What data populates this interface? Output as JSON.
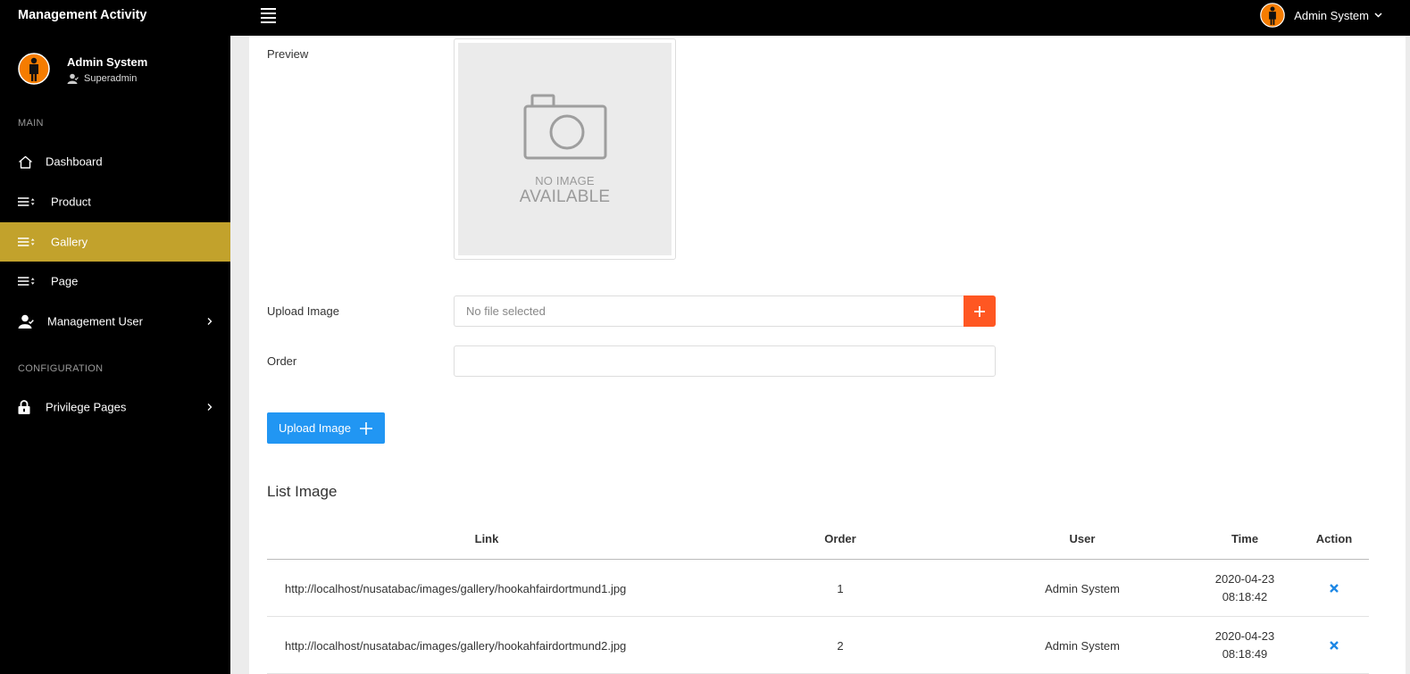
{
  "app": {
    "title": "Management Activity"
  },
  "header": {
    "user_name": "Admin System"
  },
  "sidebar": {
    "user": {
      "name": "Admin System",
      "role": "Superadmin"
    },
    "sections": {
      "main": "MAIN",
      "configuration": "CONFIGURATION"
    },
    "items": [
      {
        "label": "Dashboard",
        "icon": "home-icon"
      },
      {
        "label": "Product",
        "icon": "list-sort-icon"
      },
      {
        "label": "Gallery",
        "icon": "list-sort-icon",
        "active": true
      },
      {
        "label": "Page",
        "icon": "list-sort-icon"
      },
      {
        "label": "Management User",
        "icon": "user-icon",
        "has_children": true
      },
      {
        "label": "Privilege Pages",
        "icon": "lock-icon",
        "has_children": true
      }
    ]
  },
  "form": {
    "preview_label": "Preview",
    "no_image_line1": "NO IMAGE",
    "no_image_line2": "AVAILABLE",
    "upload_label": "Upload Image",
    "file_placeholder": "No file selected",
    "order_label": "Order",
    "order_value": "",
    "submit_label": "Upload Image"
  },
  "list": {
    "title": "List Image",
    "columns": [
      "Link",
      "Order",
      "User",
      "Time",
      "Action"
    ],
    "rows": [
      {
        "link": "http://localhost/nusatabac/images/gallery/hookahfairdortmund1.jpg",
        "order": "1",
        "user": "Admin System",
        "date": "2020-04-23",
        "time": "08:18:42"
      },
      {
        "link": "http://localhost/nusatabac/images/gallery/hookahfairdortmund2.jpg",
        "order": "2",
        "user": "Admin System",
        "date": "2020-04-23",
        "time": "08:18:49"
      }
    ]
  },
  "colors": {
    "topbar": "#000000",
    "sidebar": "#000000",
    "active_item": "#c2a22c",
    "file_button": "#ff5722",
    "primary_button": "#2196f3",
    "delete_icon": "#1e88e5",
    "avatar_orange": "#f57c00"
  }
}
